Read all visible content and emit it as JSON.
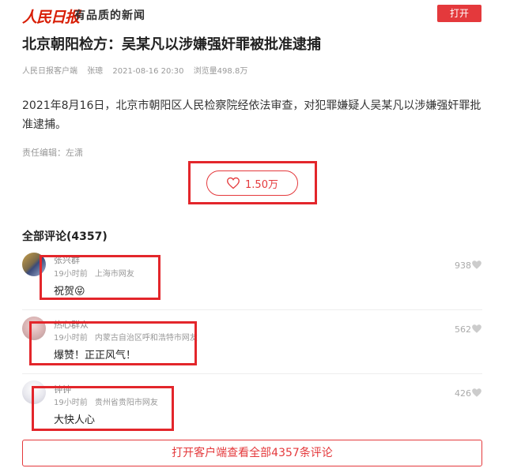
{
  "header": {
    "logo_text": "人民日报",
    "slogan": "有品质的新闻",
    "open_label": "打开"
  },
  "article": {
    "title": "北京朝阳检方：吴某凡以涉嫌强奸罪被批准逮捕",
    "source": "人民日报客户端",
    "author": "张璁",
    "datetime": "2021-08-16 20:30",
    "views": "浏览量498.8万",
    "body": "2021年8月16日，北京市朝阳区人民检察院经依法审查，对犯罪嫌疑人吴某凡以涉嫌强奸罪批准逮捕。",
    "editor": "责任编辑：左潇"
  },
  "like": {
    "count": "1.50万",
    "icon": "heart-icon"
  },
  "comments": {
    "title": "全部评论(4357)",
    "items": [
      {
        "name": "张兴群",
        "time": "19小时前",
        "location": "上海市网友",
        "text": "祝贺😝",
        "likes": "938"
      },
      {
        "name": "热心群众",
        "time": "19小时前",
        "location": "内蒙古自治区呼和浩特市网友",
        "text": "爆赞！正正风气！",
        "likes": "562"
      },
      {
        "name": "钟钟",
        "time": "19小时前",
        "location": "贵州省贵阳市网友",
        "text": "大快人心",
        "likes": "426"
      }
    ],
    "open_all_label": "打开客户端查看全部4357条评论"
  },
  "colors": {
    "brand_red": "#e4393c",
    "annotation_red": "#e3262b"
  }
}
